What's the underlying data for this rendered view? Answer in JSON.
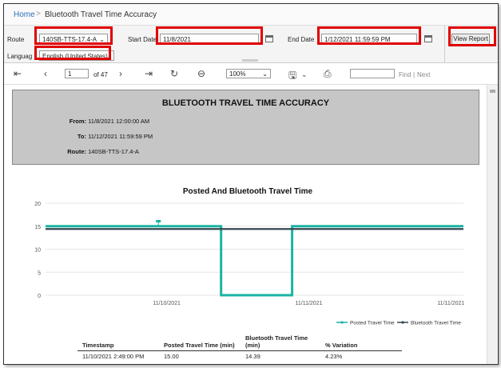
{
  "breadcrumb": {
    "home": "Home",
    "separator": ">",
    "current": "Bluetooth Travel Time Accuracy"
  },
  "params": {
    "route_label": "Route",
    "route_value": "140SB-TTS-17.4-A",
    "start_label": "Start Date",
    "start_value": "11/8/2021",
    "end_label": "End Date",
    "end_value": "1/12/2021 11:59:59 PM",
    "language_label": "Languag",
    "language_value": "English (United States)",
    "view_report": "View Report"
  },
  "toolbar": {
    "page_value": "1",
    "page_of": "of 47",
    "zoom": "100%",
    "find_placeholder": "",
    "find_label": "Find",
    "divider": "|",
    "next_label": "Next"
  },
  "report": {
    "title": "BLUETOOTH TRAVEL TIME ACCURACY",
    "from_label": "From:",
    "from_value": "11/8/2021 12:00:00 AM",
    "to_label": "To:",
    "to_value": "11/12/2021 11:59:59 PM",
    "route_label": "Route:",
    "route_value": "140SB-TTS-17.4-A"
  },
  "chart_data": {
    "type": "line",
    "title": "Posted And Bluetooth Travel Time",
    "xlabel": "",
    "ylabel": "",
    "ylim": [
      0,
      20
    ],
    "yticks": [
      0,
      5,
      10,
      15,
      20
    ],
    "xtick_labels": [
      "11/10/2021",
      "11/11/2021",
      "11/11/2021"
    ],
    "legend_position": "bottom-right",
    "series": [
      {
        "name": "Posted Travel Time",
        "color": "#1bb3a3",
        "points": [
          [
            0,
            15
          ],
          [
            0.42,
            15
          ],
          [
            0.42,
            0
          ],
          [
            0.59,
            0
          ],
          [
            0.59,
            15
          ],
          [
            1,
            15
          ]
        ],
        "marker": [
          0.27,
          16
        ]
      },
      {
        "name": "Bluetooth Travel Time",
        "color": "#37474f",
        "points": [
          [
            0,
            14.39
          ],
          [
            1,
            14.39
          ]
        ]
      }
    ]
  },
  "table": {
    "headers": [
      "Timestamp",
      "Posted Travel Time (min)",
      "Bluetooth Travel Time (min)",
      "% Variation"
    ],
    "rows": [
      [
        "11/10/2021 2:49:00 PM",
        "15.00",
        "14.39",
        "4.23%"
      ]
    ]
  }
}
